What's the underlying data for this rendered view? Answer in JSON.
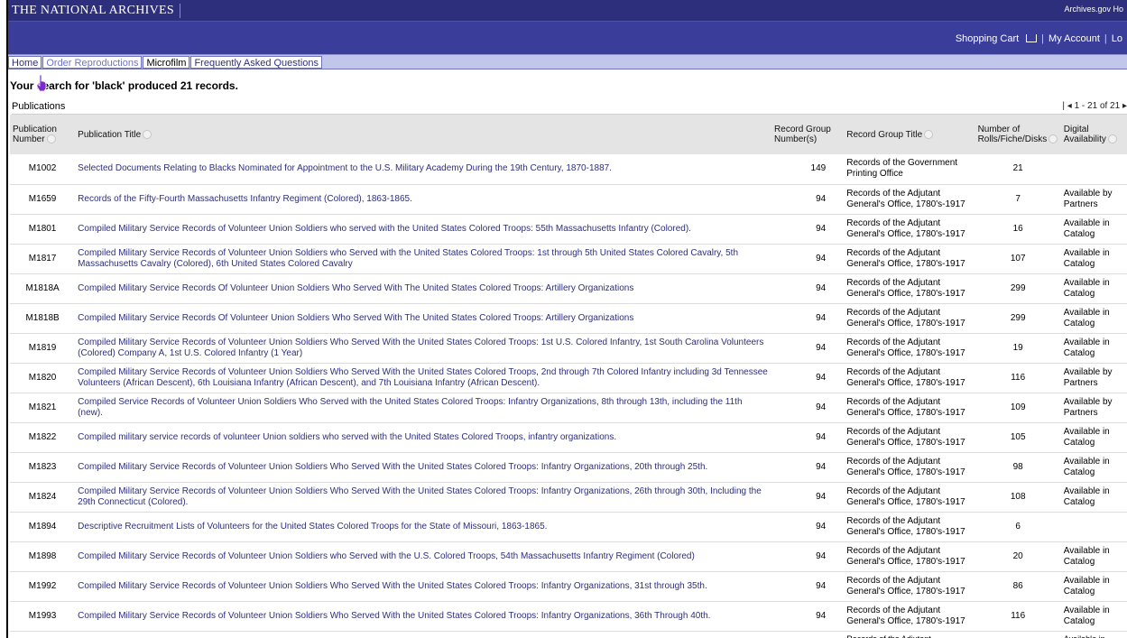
{
  "header": {
    "site_title": "THE NATIONAL ARCHIVES",
    "archives_link": "Archives.gov Ho"
  },
  "account": {
    "shopping_cart": "Shopping Cart",
    "my_account": "My Account",
    "log": "Lo"
  },
  "tabs": [
    "Home",
    "Order Reproductions",
    "Microfilm",
    "Frequently Asked Questions"
  ],
  "search": {
    "summary": "Your search for 'black' produced 21 records."
  },
  "publications": {
    "label": "Publications",
    "pager": "1 - 21 of 21"
  },
  "columns": {
    "pub_number": "Publication Number",
    "pub_title": "Publication Title",
    "rg_number": "Record Group Number(s)",
    "rg_title": "Record Group Title",
    "rolls": "Number of Rolls/Fiche/Disks",
    "digital": "Digital Availability"
  },
  "rows": [
    {
      "num": "M1002",
      "title": "Selected Documents Relating to Blacks Nominated for Appointment to the U.S. Military Academy During the 19th Century, 1870-1887.",
      "rg": "149",
      "rgt": "Records of the Government Printing Office",
      "rolls": "21",
      "dig": ""
    },
    {
      "num": "M1659",
      "title": "Records of the Fifty-Fourth Massachusetts Infantry Regiment (Colored), 1863-1865.",
      "rg": "94",
      "rgt": "Records of the Adjutant General's Office, 1780's-1917",
      "rolls": "7",
      "dig": "Available by Partners"
    },
    {
      "num": "M1801",
      "title": "Compiled Military Service Records of Volunteer Union Soldiers who served with the United States Colored Troops: 55th Massachusetts Infantry (Colored).",
      "rg": "94",
      "rgt": "Records of the Adjutant General's Office, 1780's-1917",
      "rolls": "16",
      "dig": "Available in Catalog"
    },
    {
      "num": "M1817",
      "title": "Compiled Military Service Records of Volunteer Union Soldiers who Served with the United States Colored Troops: 1st through 5th United States Colored Cavalry, 5th Massachusetts Cavalry (Colored), 6th United States Colored Cavalry",
      "rg": "94",
      "rgt": "Records of the Adjutant General's Office, 1780's-1917",
      "rolls": "107",
      "dig": "Available in Catalog"
    },
    {
      "num": "M1818A",
      "title": "Compiled Military Service Records Of Volunteer Union Soldiers Who Served With The United States Colored Troops: Artillery Organizations",
      "rg": "94",
      "rgt": "Records of the Adjutant General's Office, 1780's-1917",
      "rolls": "299",
      "dig": "Available in Catalog"
    },
    {
      "num": "M1818B",
      "title": "Compiled Military Service Records Of Volunteer Union Soldiers Who Served With The United States Colored Troops: Artillery Organizations",
      "rg": "94",
      "rgt": "Records of the Adjutant General's Office, 1780's-1917",
      "rolls": "299",
      "dig": "Available in Catalog"
    },
    {
      "num": "M1819",
      "title": "Compiled Military Service Records of Volunteer Union Soldiers Who Served With the United States Colored Troops: 1st U.S. Colored Infantry, 1st South Carolina Volunteers (Colored) Company A, 1st U.S. Colored Infantry (1 Year)",
      "rg": "94",
      "rgt": "Records of the Adjutant General's Office, 1780's-1917",
      "rolls": "19",
      "dig": "Available in Catalog"
    },
    {
      "num": "M1820",
      "title": "Compiled Military Service Records of Volunteer Union Soldiers Who Served With the United States Colored Troops, 2nd through 7th Colored Infantry including 3d Tennessee Volunteers (African Descent), 6th Louisiana Infantry (African Descent), and 7th Louisiana Infantry (African Descent).",
      "rg": "94",
      "rgt": "Records of the Adjutant General's Office, 1780's-1917",
      "rolls": "116",
      "dig": "Available by Partners"
    },
    {
      "num": "M1821",
      "title": "Compiled Service Records of Volunteer Union Soldiers Who Served with the United States Colored Troops: Infantry Organizations, 8th through 13th, including the 11th (new).",
      "rg": "94",
      "rgt": "Records of the Adjutant General's Office, 1780's-1917",
      "rolls": "109",
      "dig": "Available by Partners"
    },
    {
      "num": "M1822",
      "title": "Compiled military service records of volunteer Union soldiers who served with the United States Colored Troops, infantry organizations.",
      "rg": "94",
      "rgt": "Records of the Adjutant General's Office, 1780's-1917",
      "rolls": "105",
      "dig": "Available in Catalog"
    },
    {
      "num": "M1823",
      "title": "Compiled Military Service Records of Volunteer Union Soldiers Who Served With the United States Colored Troops: Infantry Organizations, 20th through 25th.",
      "rg": "94",
      "rgt": "Records of the Adjutant General's Office, 1780's-1917",
      "rolls": "98",
      "dig": "Available in Catalog"
    },
    {
      "num": "M1824",
      "title": "Compiled Military Service Records of Volunteer Union Soldiers Who Served With the United States Colored Troops: Infantry Organizations, 26th through 30th, Including the 29th Connecticut (Colored).",
      "rg": "94",
      "rgt": "Records of the Adjutant General's Office, 1780's-1917",
      "rolls": "108",
      "dig": "Available in Catalog"
    },
    {
      "num": "M1894",
      "title": "Descriptive Recruitment Lists of Volunteers for the United States Colored Troops for the State of Missouri, 1863-1865.",
      "rg": "94",
      "rgt": "Records of the Adjutant General's Office, 1780's-1917",
      "rolls": "6",
      "dig": ""
    },
    {
      "num": "M1898",
      "title": "Compiled Military Service Records of Volunteer Union Soldiers who Served with the U.S. Colored Troops, 54th Massachusetts Infantry Regiment (Colored)",
      "rg": "94",
      "rgt": "Records of the Adjutant General's Office, 1780's-1917",
      "rolls": "20",
      "dig": "Available in Catalog"
    },
    {
      "num": "M1992",
      "title": "Compiled Military Service Records of Volunteer Union Soldiers Who Served With the United States Colored Troops: Infantry Organizations, 31st through 35th.",
      "rg": "94",
      "rgt": "Records of the Adjutant General's Office, 1780's-1917",
      "rolls": "86",
      "dig": "Available in Catalog"
    },
    {
      "num": "M1993",
      "title": "Compiled Military Service Records of Volunteer Union Soldiers Who Served With the United States Colored Troops: Infantry Organizations, 36th Through 40th.",
      "rg": "94",
      "rgt": "Records of the Adjutant General's Office, 1780's-1917",
      "rolls": "116",
      "dig": "Available in Catalog"
    }
  ],
  "partial_row": {
    "rgt": "Records of the Adjutant",
    "dig": "Available in"
  }
}
